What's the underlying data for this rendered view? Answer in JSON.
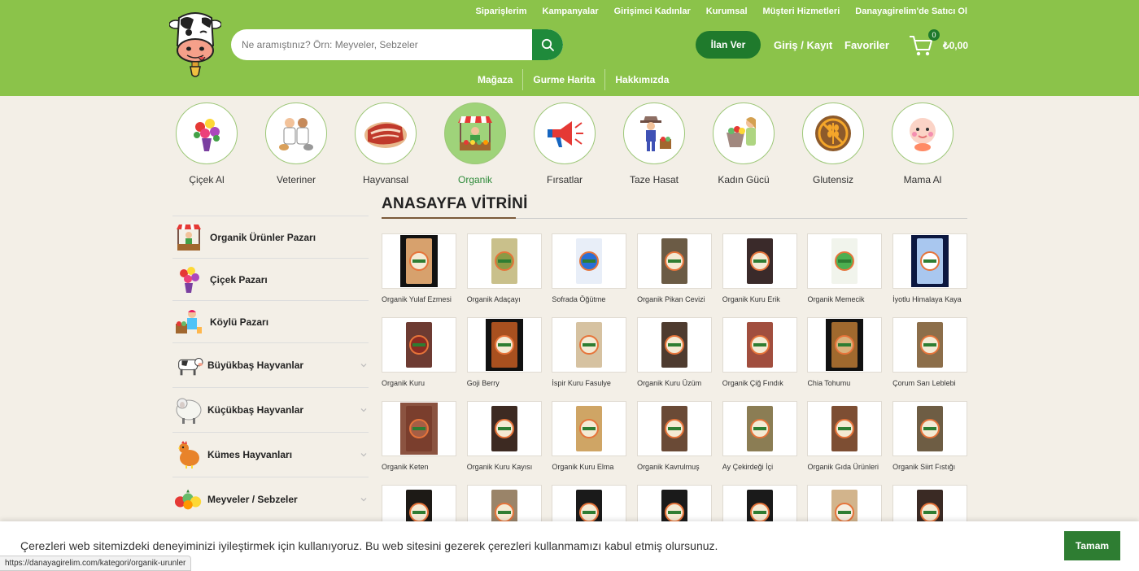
{
  "header": {
    "top_links": [
      "Siparişlerim",
      "Kampanyalar",
      "Girişimci Kadınlar",
      "Kurumsal",
      "Müşteri Hizmetleri",
      "Danayagirelim'de Satıcı Ol"
    ],
    "search_placeholder": "Ne aramıştınız? Örn: Meyveler, Sebzeler",
    "ilan_button": "İlan Ver",
    "login": "Giriş / Kayıt",
    "favorites": "Favoriler",
    "cart_count": "0",
    "cart_total": "₺0,00",
    "main_nav": [
      "Mağaza",
      "Gurme Harita",
      "Hakkımızda"
    ],
    "colors": {
      "header_bg": "#8bc34a",
      "primary_green": "#1f7a2c",
      "page_bg": "#f3efe7"
    }
  },
  "categories": [
    {
      "label": "Çiçek Al",
      "icon": "flower-bouquet-icon"
    },
    {
      "label": "Veteriner",
      "icon": "veterinarians-icon"
    },
    {
      "label": "Hayvansal",
      "icon": "meat-icon"
    },
    {
      "label": "Organik",
      "icon": "market-stall-icon",
      "active": true
    },
    {
      "label": "Fırsatlar",
      "icon": "megaphone-icon"
    },
    {
      "label": "Taze Hasat",
      "icon": "farmer-icon"
    },
    {
      "label": "Kadın Gücü",
      "icon": "woman-shopping-icon"
    },
    {
      "label": "Glutensiz",
      "icon": "gluten-free-icon"
    },
    {
      "label": "Mama Al",
      "icon": "baby-icon"
    }
  ],
  "sidebar": [
    {
      "label": "Organik Ürünler Pazarı",
      "icon": "market-stall-icon"
    },
    {
      "label": "Çiçek Pazarı",
      "icon": "flower-bouquet-icon"
    },
    {
      "label": "Köylü Pazarı",
      "icon": "villager-icon"
    },
    {
      "label": "Büyükbaş Hayvanlar",
      "icon": "cow-icon"
    },
    {
      "label": "Küçükbaş Hayvanlar",
      "icon": "sheep-icon"
    },
    {
      "label": "Kümes Hayvanları",
      "icon": "chicken-icon"
    },
    {
      "label": "Meyveler / Sebzeler",
      "icon": "fruits-vegetables-icon"
    }
  ],
  "vitrin_title": "ANASAYFA VİTRİNİ",
  "products": [
    "Organik Yulaf Ezmesi",
    "Organik Adaçayı",
    "Sofrada Öğütme",
    "Organik Pikan Cevizi",
    "Organik Kuru Erik",
    "Organik Memecik",
    "İyotlu Himalaya Kaya",
    "Organik Kuru",
    "Goji Berry",
    "İspir Kuru Fasulye",
    "Organik Kuru Üzüm",
    "Organik Çiğ Fındık",
    "Chia Tohumu",
    "Çorum Sarı Leblebi",
    "Organik Keten",
    "Organik Kuru Kayısı",
    "Organik Kuru Elma",
    "Organik Kavrulmuş",
    "Ay Çekirdeği İçi",
    "Organik Gıda Ürünleri",
    "Organik Siirt Fıstığı",
    "",
    "",
    "",
    "",
    "",
    "",
    ""
  ],
  "cookie": {
    "text": "Çerezleri web sitemizdeki deneyiminizi iyileştirmek için kullanıyoruz. Bu web sitesini gezerek çerezleri kullanmamızı kabul etmiş olursunuz.",
    "button": "Tamam"
  },
  "status_url": "https://danayagirelim.com/kategori/organik-urunler"
}
